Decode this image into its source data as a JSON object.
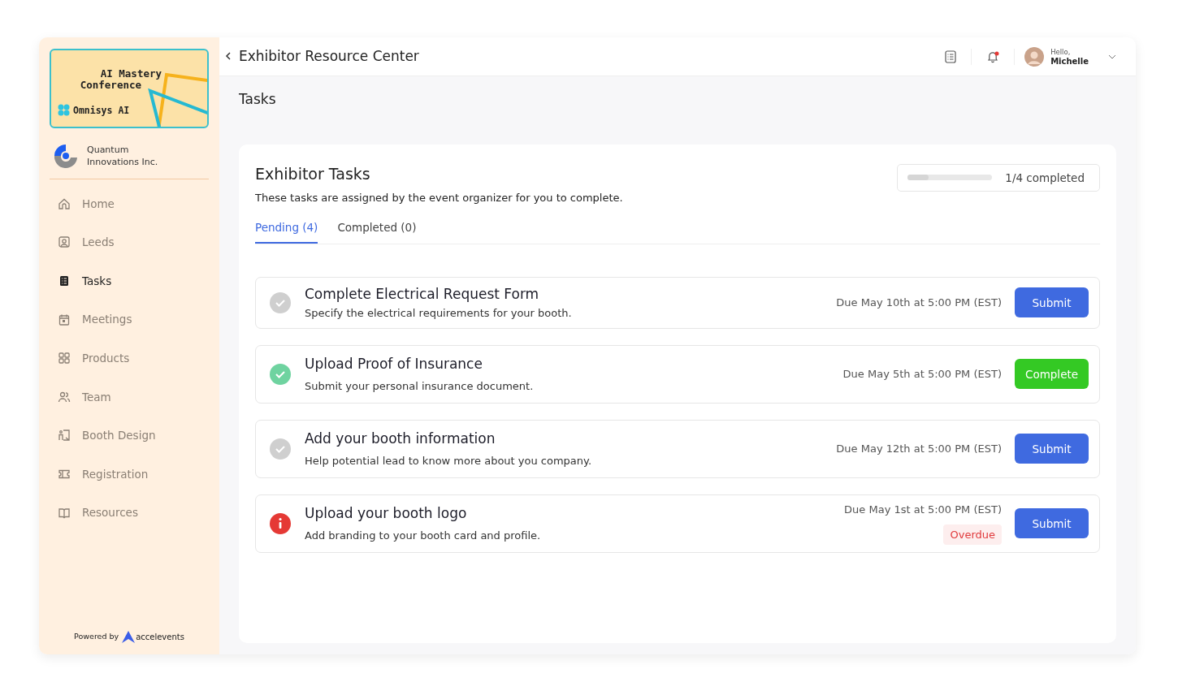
{
  "sidebar": {
    "event_banner": {
      "title_line_1": "AI Mastery",
      "title_line_2": "Conference",
      "brand": "Omnisys AI"
    },
    "company": {
      "line_1": "Quantum",
      "line_2": "Innovations Inc."
    },
    "items": [
      {
        "label": "Home",
        "selected": false
      },
      {
        "label": "Leeds",
        "selected": false
      },
      {
        "label": "Tasks",
        "selected": true
      },
      {
        "label": "Meetings",
        "selected": false
      },
      {
        "label": "Products",
        "selected": false
      },
      {
        "label": "Team",
        "selected": false
      },
      {
        "label": "Booth Design",
        "selected": false
      },
      {
        "label": "Registration",
        "selected": false
      },
      {
        "label": "Resources",
        "selected": false
      }
    ],
    "footer": {
      "powered_by": "Powered by",
      "brand": "accelevents"
    }
  },
  "header": {
    "title": "Exhibitor Resource Center",
    "notification_unread": true,
    "greeting": "Hello,",
    "user": "Michelle"
  },
  "page_title": "Tasks",
  "panel": {
    "title": "Exhibitor Tasks",
    "description": "These tasks are assigned by the event organizer for you to complete.",
    "progress": {
      "level": 0.25,
      "reading": "1/4 completed"
    },
    "tabs": [
      {
        "label": "Pending (4)",
        "selected": true
      },
      {
        "label": "Completed (0)",
        "selected": false
      }
    ],
    "tasks": [
      {
        "kind": "pending",
        "title": "Complete Electrical Request Form",
        "description": "Specify the electrical requirements for your booth.",
        "due": "Due May 10th at 5:00 PM (EST)",
        "action": {
          "kind": "submit",
          "label": "Submit"
        }
      },
      {
        "kind": "done",
        "title": "Upload Proof of Insurance",
        "description": "Submit your personal insurance document.",
        "due": "Due May 5th at 5:00 PM (EST)",
        "action": {
          "kind": "complete",
          "label": "Complete"
        }
      },
      {
        "kind": "pending",
        "title": "Add your booth information",
        "description": "Help potential lead to know more about you company.",
        "due": "Due May 12th at 5:00 PM (EST)",
        "action": {
          "kind": "submit",
          "label": "Submit"
        }
      },
      {
        "kind": "overdue",
        "title": "Upload your booth logo",
        "description": "Add branding to your booth card and profile.",
        "due": "Due May 1st at 5:00 PM (EST)",
        "badge": "Overdue",
        "action": {
          "kind": "submit",
          "label": "Submit"
        }
      }
    ]
  }
}
